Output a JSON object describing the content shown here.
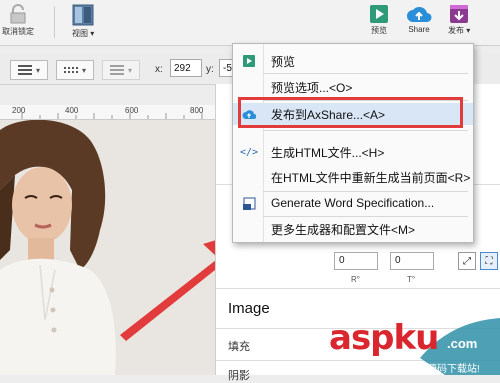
{
  "toolbar": {
    "unlock_label": "取消锁定",
    "view_label": "视图",
    "preview_label": "预览",
    "share_label": "Share",
    "publish_label": "发布"
  },
  "coords": {
    "x_label": "x:",
    "x_value": "292",
    "y_label": "y:",
    "y_value": "-5"
  },
  "ruler": {
    "ticks": [
      "200",
      "400",
      "600",
      "800"
    ]
  },
  "menu": {
    "items": [
      {
        "label": "预览",
        "icon": "play-icon"
      },
      {
        "label": "预览选项...<O>",
        "icon": ""
      },
      {
        "label": "发布到AxShare...<A>",
        "icon": "cloud-upload-icon"
      },
      {
        "label": "生成HTML文件...<H>",
        "icon": "code-icon"
      },
      {
        "label": "在HTML文件中重新生成当前页面<R>",
        "icon": ""
      },
      {
        "label": "Generate Word Specification...",
        "icon": "word-doc-icon"
      },
      {
        "label": "更多生成器和配置文件<M>",
        "icon": ""
      }
    ]
  },
  "panel": {
    "r_value": "0",
    "r_caption": "R°",
    "t_value": "0",
    "t_caption": "T°",
    "section_title": "Image",
    "fill_label": "填充",
    "shadow_label": "阴影"
  },
  "watermark": {
    "brand_main": "aspku",
    "brand_tld": ".com",
    "tagline": "免费网站源码下载站!"
  },
  "colors": {
    "highlight": "#e23b3b",
    "share_blue": "#2a8fd8",
    "preview_green": "#2f9a78",
    "publish_purple": "#8b3a8f"
  }
}
